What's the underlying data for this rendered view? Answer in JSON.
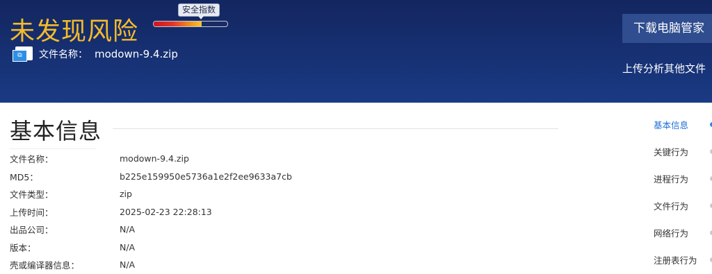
{
  "header": {
    "verdict": "未发现风险",
    "safety_badge": "安全指数",
    "safety_level": 0.65,
    "file_label": "文件名称：",
    "file_name": "modown-9.4.zip",
    "file_icon": "zip-file-icon",
    "download_button": "下载电脑管家",
    "upload_link": "上传分析其他文件"
  },
  "section": {
    "title": "基本信息"
  },
  "info": [
    {
      "key": "文件名称：",
      "value": "modown-9.4.zip"
    },
    {
      "key": "MD5：",
      "value": "b225e159950e5736a1e2f2ee9633a7cb"
    },
    {
      "key": "文件类型：",
      "value": "zip"
    },
    {
      "key": "上传时间：",
      "value": "2025-02-23 22:28:13"
    },
    {
      "key": "出品公司：",
      "value": "N/A"
    },
    {
      "key": "版本：",
      "value": "N/A"
    },
    {
      "key": "壳或编译器信息：",
      "value": "N/A"
    }
  ],
  "sidenav": [
    {
      "label": "基本信息",
      "active": true
    },
    {
      "label": "关键行为",
      "active": false
    },
    {
      "label": "进程行为",
      "active": false
    },
    {
      "label": "文件行为",
      "active": false
    },
    {
      "label": "网络行为",
      "active": false
    },
    {
      "label": "注册表行为",
      "active": false
    }
  ],
  "colors": {
    "header_bg": "#173275",
    "verdict": "#f4bb2b",
    "active_nav": "#1d6fd6"
  }
}
